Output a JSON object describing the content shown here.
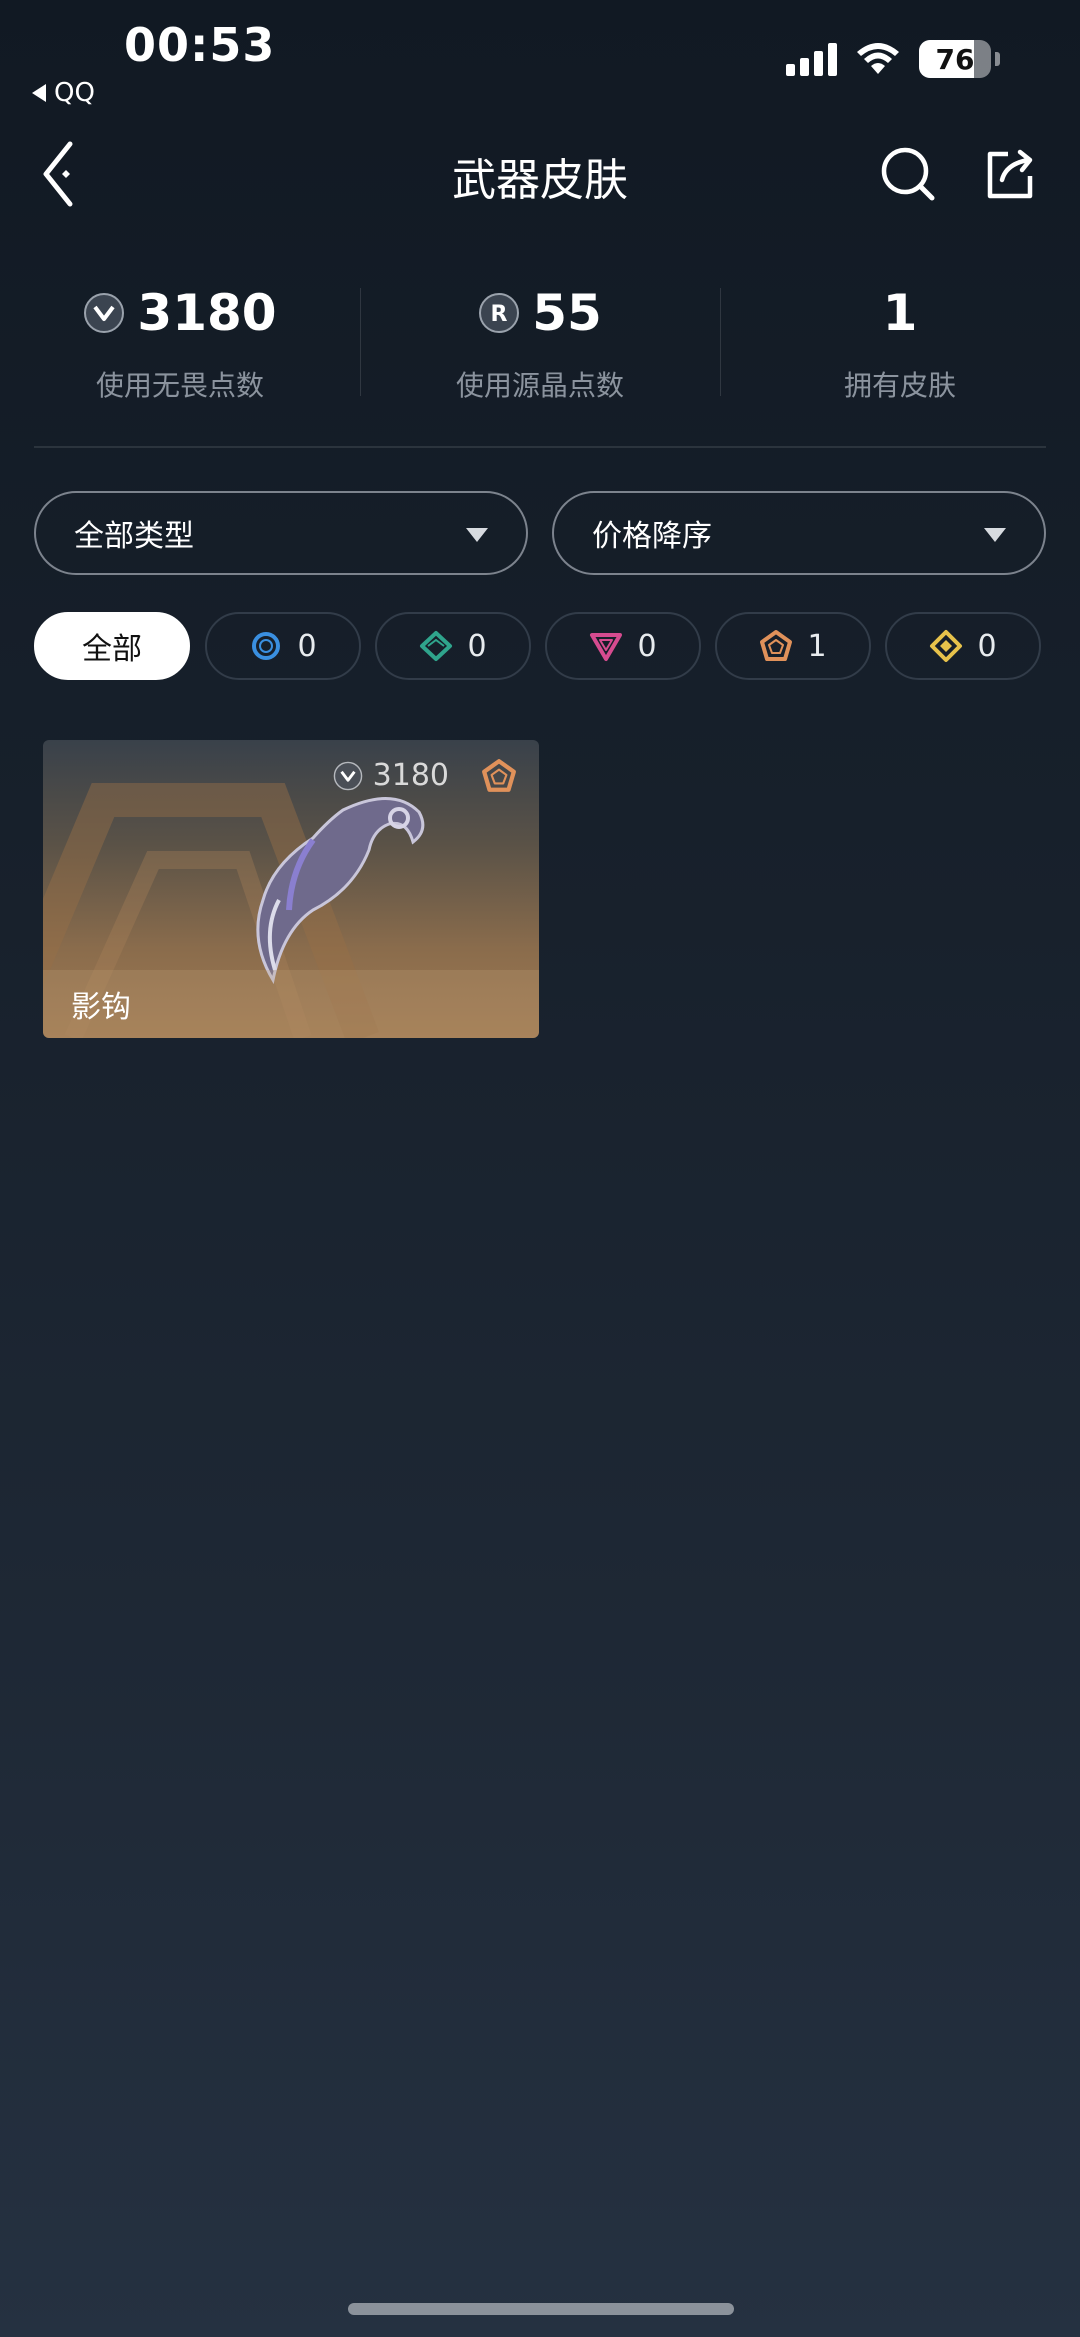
{
  "status_bar": {
    "time": "00:53",
    "back_app": "QQ",
    "battery": "76",
    "battery_level": 0.76
  },
  "nav": {
    "title": "武器皮肤",
    "icons": [
      "back-icon",
      "search-icon",
      "share-icon"
    ]
  },
  "stats": [
    {
      "icon": "vp-coin-icon",
      "value": "3180",
      "label": "使用无畏点数"
    },
    {
      "icon": "radianite-coin-icon",
      "value": "55",
      "label": "使用源晶点数"
    },
    {
      "icon": "",
      "value": "1",
      "label": "拥有皮肤"
    }
  ],
  "filters": {
    "type_select": "全部类型",
    "sort_select": "价格降序"
  },
  "tiers": [
    {
      "label": "全部",
      "active": true
    },
    {
      "icon": "select-tier-icon",
      "count": "0",
      "color": "#3a8fe0"
    },
    {
      "icon": "deluxe-tier-icon",
      "count": "0",
      "color": "#2fa48c"
    },
    {
      "icon": "premium-tier-icon",
      "count": "0",
      "color": "#d64b8f"
    },
    {
      "icon": "exclusive-tier-icon",
      "count": "1",
      "color": "#e0915a"
    },
    {
      "icon": "ultra-tier-icon",
      "count": "0",
      "color": "#e7c24b"
    }
  ],
  "skins": [
    {
      "name": "影钩",
      "price": "3180",
      "tier_icon": "exclusive-tier-icon",
      "tier_color": "#e0915a"
    }
  ]
}
